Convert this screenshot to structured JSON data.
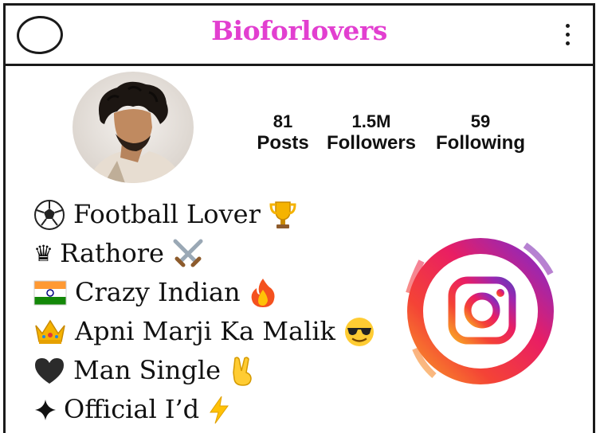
{
  "header": {
    "brand": "Bioforlovers",
    "brand_color": "#e23fd0"
  },
  "profile": {
    "stats": [
      {
        "value": "81",
        "label": "Posts"
      },
      {
        "value": "1.5M",
        "label": "Followers"
      },
      {
        "value": "59",
        "label": "Following"
      }
    ]
  },
  "bio": [
    {
      "icon": "soccer-ball-icon",
      "text": "Football Lover",
      "trailing_icon": "trophy-icon"
    },
    {
      "icon": "chess-queen-icon",
      "text": "Rathore",
      "trailing_icon": "crossed-swords-icon"
    },
    {
      "icon": "india-flag-icon",
      "text": "Crazy Indian",
      "trailing_icon": "fire-icon"
    },
    {
      "icon": "crown-icon",
      "text": "Apni Marji Ka Malik",
      "trailing_icon": "sunglasses-face-icon"
    },
    {
      "icon": "black-heart-icon",
      "text": "Man Single",
      "trailing_icon": "victory-hand-icon"
    },
    {
      "icon": "four-point-star-icon",
      "text": "Official I’d",
      "trailing_icon": "lightning-icon"
    }
  ],
  "colors": {
    "instagram_gradient": [
      "#f9a825",
      "#f44336",
      "#e91e63",
      "#9c27b0",
      "#673ab7"
    ]
  }
}
